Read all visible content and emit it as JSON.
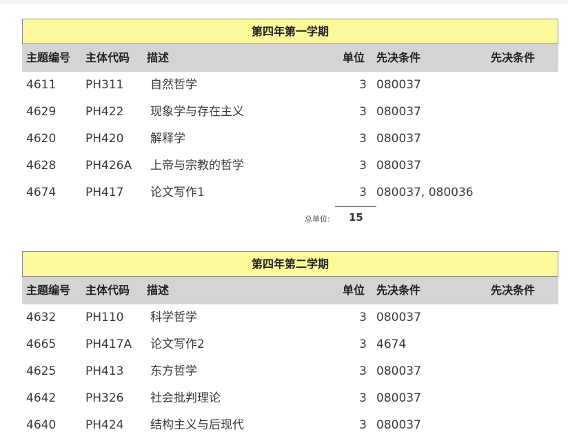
{
  "headers": {
    "topic_id": "主题编号",
    "subject_code": "主体代码",
    "description": "描述",
    "units": "单位",
    "prerequisite_1": "先决条件",
    "prerequisite_2": "先决条件"
  },
  "semesters": [
    {
      "title": "第四年第一学期",
      "courses": [
        {
          "id": "4611",
          "code": "PH311",
          "desc": "自然哲学",
          "units": "3",
          "prereq": "080037"
        },
        {
          "id": "4629",
          "code": "PH422",
          "desc": "现象学与存在主义",
          "units": "3",
          "prereq": "080037"
        },
        {
          "id": "4620",
          "code": "PH420",
          "desc": "解释学",
          "units": "3",
          "prereq": "080037"
        },
        {
          "id": "4628",
          "code": "PH426A",
          "desc": "上帝与宗教的哲学",
          "units": "3",
          "prereq": "080037"
        },
        {
          "id": "4674",
          "code": "PH417",
          "desc": "论文写作1",
          "units": "3",
          "prereq": "080037, 080036"
        }
      ],
      "total_label": "总单位:",
      "total_value": "15"
    },
    {
      "title": "第四年第二学期",
      "courses": [
        {
          "id": "4632",
          "code": "PH110",
          "desc": "科学哲学",
          "units": "3",
          "prereq": "080037"
        },
        {
          "id": "4665",
          "code": "PH417A",
          "desc": "论文写作2",
          "units": "3",
          "prereq": "4674"
        },
        {
          "id": "4625",
          "code": "PH413",
          "desc": "东方哲学",
          "units": "3",
          "prereq": "080037"
        },
        {
          "id": "4642",
          "code": "PH326",
          "desc": "社会批判理论",
          "units": "3",
          "prereq": "080037"
        },
        {
          "id": "4640",
          "code": "PH424",
          "desc": "结构主义与后现代",
          "units": "3",
          "prereq": "080037"
        }
      ]
    }
  ],
  "colors": {
    "title_bg": "#fcf99c",
    "header_bg": "#d4d4d4"
  }
}
